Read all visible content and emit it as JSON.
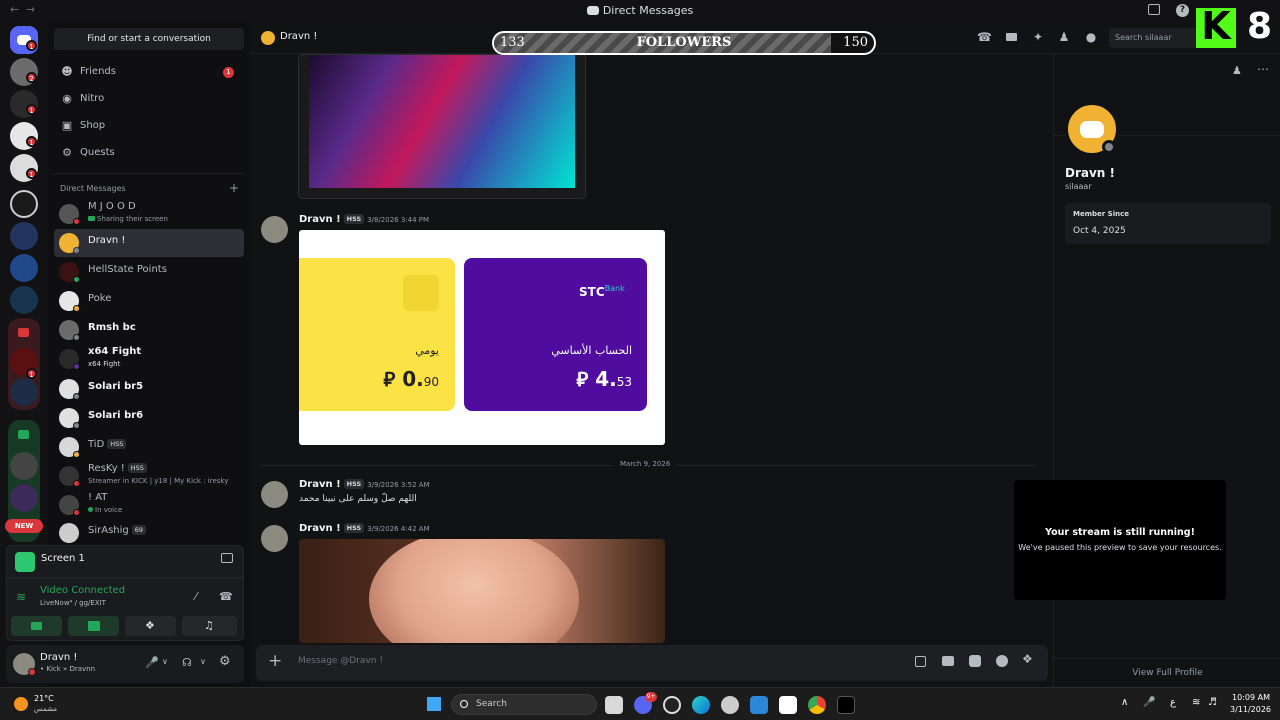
{
  "window": {
    "title": "Direct Messages"
  },
  "overlay": {
    "followers_current": "133",
    "followers_label": "FOLLOWERS",
    "followers_goal": "150",
    "kick_count": "8"
  },
  "servers": {
    "badges": [
      "1",
      "2",
      "1",
      "1",
      "1",
      "1",
      "1"
    ],
    "new_label": "NEW"
  },
  "sidebar": {
    "search_placeholder": "Find or start a conversation",
    "nav": [
      {
        "label": "Friends",
        "badge": "1"
      },
      {
        "label": "Nitro"
      },
      {
        "label": "Shop"
      },
      {
        "label": "Quests"
      }
    ],
    "dm_header": "Direct Messages",
    "dms": [
      {
        "name": "M J O O D",
        "sub": "Sharing their screen"
      },
      {
        "name": "Dravn !"
      },
      {
        "name": "HellState Points"
      },
      {
        "name": "Poke"
      },
      {
        "name": "Rmsh bc"
      },
      {
        "name": "x64 Fight",
        "sub": "x64 Fight"
      },
      {
        "name": "Solari br5"
      },
      {
        "name": "Solari br6"
      },
      {
        "name": "TiD",
        "tag": "HSS"
      },
      {
        "name": "ResKy !",
        "tag": "HSS",
        "sub": "Streamer in KICK | y18 | My Kick : iresky"
      },
      {
        "name": "! AT",
        "sub": "In voice"
      },
      {
        "name": "SirAshig",
        "tag": "69"
      }
    ]
  },
  "voice": {
    "screen_label": "Screen 1",
    "status": "Video Connected",
    "channel": "LiveNow⁴ / gg/EXIT"
  },
  "user": {
    "name": "Dravn !",
    "status": "• Kick » Dravnn"
  },
  "chat": {
    "header_name": "Dravn !",
    "search_placeholder": "Search silaaar",
    "messages": [
      {
        "author": "Dravn !",
        "tag": "HSS",
        "time": "3/8/2026 3:44 PM"
      },
      {
        "author": "Dravn !",
        "tag": "HSS",
        "time": "3/9/2026 3:52 AM",
        "text": "اللهم صلّ وسلم على نبينا محمد"
      },
      {
        "author": "Dravn !",
        "tag": "HSS",
        "time": "3/9/2026 4:42 AM"
      }
    ],
    "date_divider": "March 9, 2026",
    "composer_placeholder": "Message @Dravn !"
  },
  "bank_card": {
    "left_label": "يومي",
    "left_amount": "0.",
    "left_decimal": "90",
    "brand": "STC",
    "brand_sup": "Bank",
    "right_label": "الحساب الأساسي",
    "right_amount": "4.",
    "right_decimal": "53"
  },
  "profile": {
    "name": "Dravn !",
    "username": "silaaar",
    "member_since_label": "Member Since",
    "member_since": "Oct 4, 2025",
    "view_full": "View Full Profile"
  },
  "stream_notice": {
    "title": "Your stream is still running!",
    "body": "We've paused this preview to save your resources."
  },
  "taskbar": {
    "weather_temp": "21°C",
    "weather_desc": "مشمس",
    "search": "Search",
    "lang": "ع",
    "time": "10:09 AM",
    "date": "3/11/2026",
    "discord_badge": "9+"
  },
  "colors": {
    "accent": "#5865f2",
    "card_yellow": "#fbe245",
    "card_purple": "#4f0c9e",
    "green": "#23a55a",
    "red": "#da373c"
  }
}
